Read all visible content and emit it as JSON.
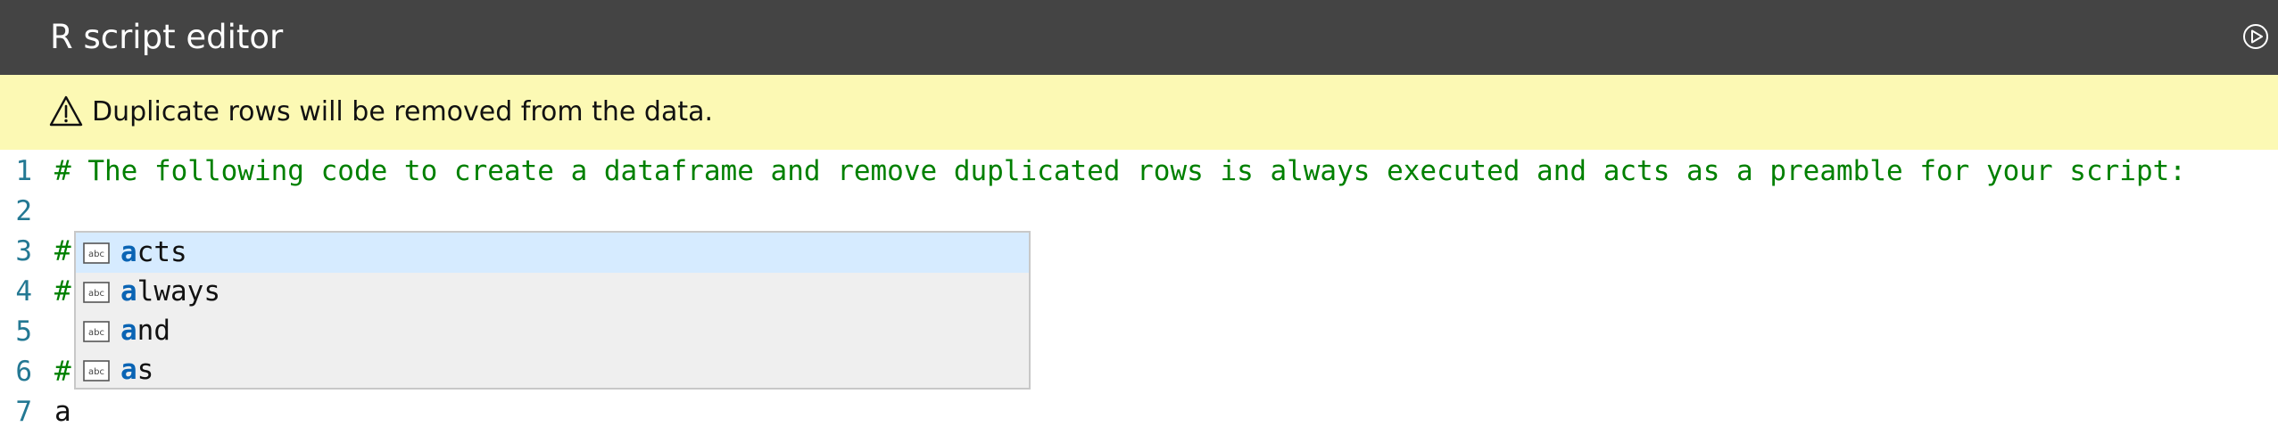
{
  "window": {
    "title": "R script editor",
    "run_icon": "play-circle-icon"
  },
  "warning": {
    "icon": "warning-triangle-icon",
    "message": "Duplicate rows will be removed from the data."
  },
  "editor": {
    "lines": [
      {
        "number": "1",
        "text": "# The following code to create a dataframe and remove duplicated rows is always executed and acts as a preamble for your script:"
      },
      {
        "number": "2",
        "text": ""
      },
      {
        "number": "3",
        "text": "#"
      },
      {
        "number": "4",
        "text": "#"
      },
      {
        "number": "5",
        "text": ""
      },
      {
        "number": "6",
        "text": "#"
      },
      {
        "number": "7",
        "text": "a"
      }
    ],
    "colors": {
      "comment": "#008000",
      "line_number": "#237893",
      "match_highlight": "#0a64b4",
      "selected_suggestion": "#d6ebff",
      "warning_background": "#fcf9b4",
      "titlebar_background": "#444444"
    }
  },
  "suggestions": {
    "icon": "text-word-icon",
    "selected_index": 0,
    "items": [
      {
        "match": "a",
        "rest": "cts"
      },
      {
        "match": "a",
        "rest": "lways"
      },
      {
        "match": "a",
        "rest": "nd"
      },
      {
        "match": "a",
        "rest": "s"
      }
    ]
  }
}
